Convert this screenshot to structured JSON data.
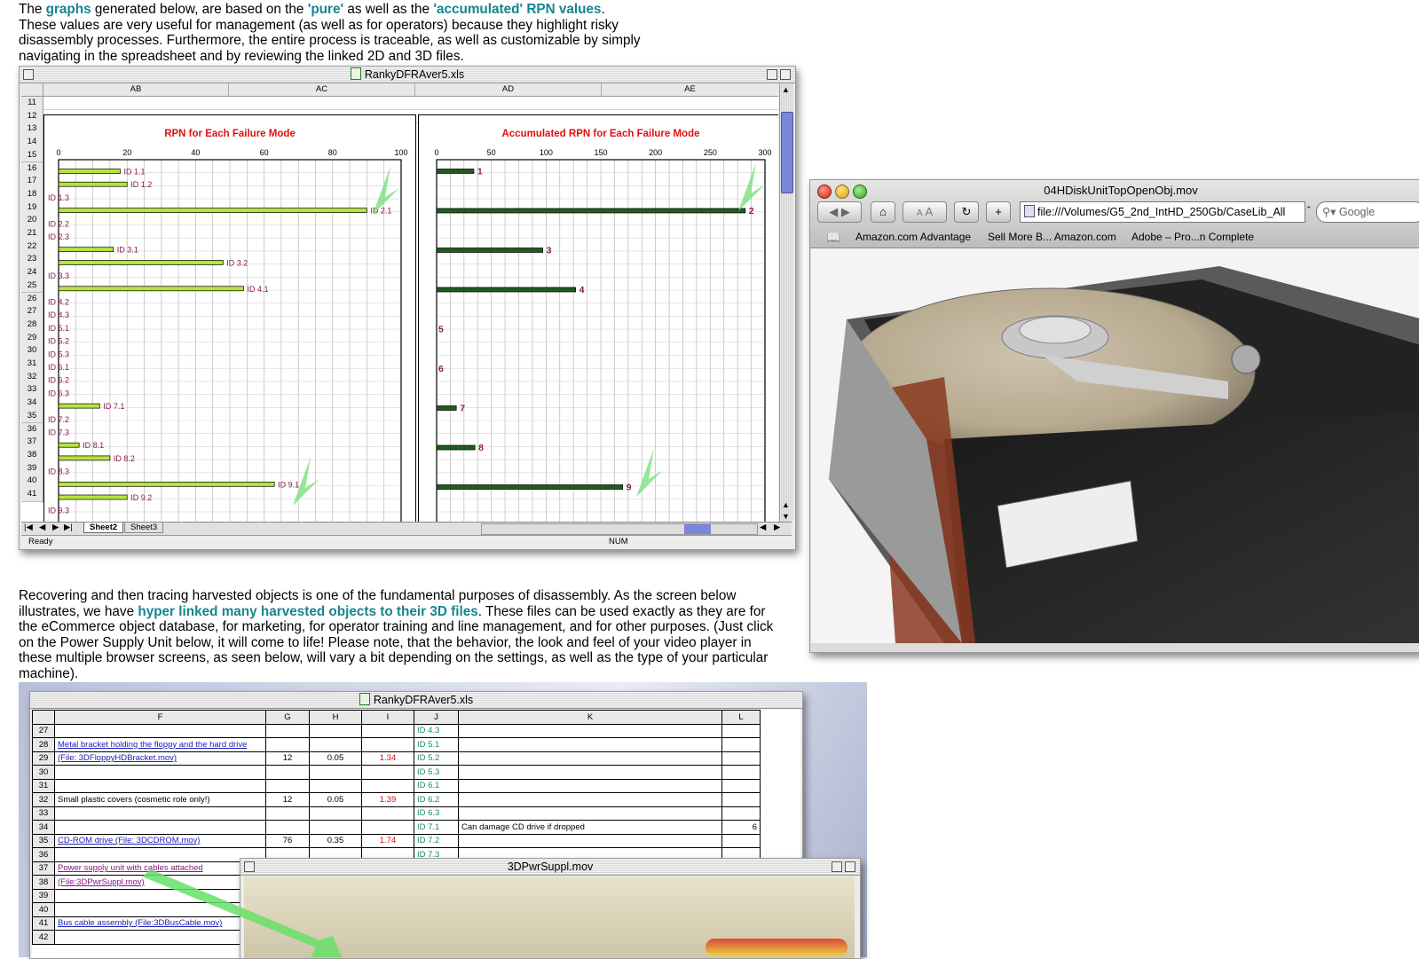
{
  "intro": {
    "t1": "The ",
    "graphs_link": "graphs",
    "t2": " generated below, are based on the ",
    "pure_link": "'pure'",
    "t3": " as well as the ",
    "accum_link": "'accumulated' RPN values",
    "t4": ".",
    "line2": "These values are very useful for management (as well as for operators) because they highlight risky",
    "line3": "disassembly processes. Furthermore, the entire process is traceable, as well as customizable by simply",
    "line4": "navigating in the spreadsheet and by reviewing the linked 2D and 3D files."
  },
  "excel1": {
    "title": "RankyDFRAver5.xls",
    "columns": [
      "AB",
      "AC",
      "AD",
      "AE"
    ],
    "rows": [
      "11",
      "12",
      "13",
      "14",
      "15",
      "16",
      "17",
      "18",
      "19",
      "20",
      "21",
      "22",
      "23",
      "24",
      "25",
      "26",
      "27",
      "28",
      "29",
      "30",
      "31",
      "32",
      "33",
      "34",
      "35",
      "36",
      "37",
      "38",
      "39",
      "40",
      "41"
    ],
    "tabs": [
      "Sheet2",
      "Sheet3"
    ],
    "status_left": "Ready",
    "status_num": "NUM"
  },
  "chart_data": [
    {
      "type": "bar",
      "orientation": "horizontal",
      "title": "RPN for Each Failure Mode",
      "categories": [
        "ID 1.1",
        "ID 1.2",
        "ID 1.3",
        "ID 2.1",
        "ID 2.2",
        "ID 2.3",
        "ID 3.1",
        "ID 3.2",
        "ID 3.3",
        "ID 4.1",
        "ID 4.2",
        "ID 4.3",
        "ID 5.1",
        "ID 5.2",
        "ID 5.3",
        "ID 6.1",
        "ID 6.2",
        "ID 6.3",
        "ID 7.1",
        "ID 7.2",
        "ID 7.3",
        "ID 8.1",
        "ID 8.2",
        "ID 8.3",
        "ID 9.1",
        "ID 9.2",
        "ID 9.3"
      ],
      "values": [
        18,
        20,
        0,
        90,
        0,
        0,
        16,
        48,
        0,
        54,
        0,
        0,
        0,
        0,
        0,
        0,
        0,
        0,
        12,
        0,
        0,
        6,
        15,
        0,
        63,
        20,
        0
      ],
      "xticks": [
        "0",
        "20",
        "40",
        "60",
        "80",
        "100"
      ],
      "xlim": [
        0,
        100
      ],
      "grid": true,
      "colors": {
        "bar": "#b7e33c",
        "label": "#8a1a4a",
        "title": "#e01010"
      }
    },
    {
      "type": "bar",
      "orientation": "horizontal",
      "title": "Accumulated RPN for Each Failure Mode",
      "categories": [
        "1",
        "2",
        "3",
        "4",
        "5",
        "6",
        "7",
        "8",
        "9"
      ],
      "values": [
        34,
        282,
        97,
        127,
        0,
        0,
        18,
        35,
        170
      ],
      "xticks": [
        "0",
        "50",
        "100",
        "150",
        "200",
        "250",
        "300"
      ],
      "xlim": [
        0,
        300
      ],
      "grid": true,
      "colors": {
        "bar": "#1f5a22",
        "label": "#8a1a4a",
        "title": "#e01010"
      }
    }
  ],
  "safari": {
    "title": "04HDiskUnitTopOpenObj.mov",
    "address": "file:///Volumes/G5_2nd_IntHD_250Gb/CaseLib_All",
    "search_placeholder": "Google",
    "font_smaller": "A",
    "font_larger": "A",
    "bookmarks": [
      "Amazon.com Advantage",
      "Sell More B... Amazon.com",
      "Adobe – Pro...n Complete"
    ]
  },
  "para2": {
    "l1": "Recovering and then tracing harvested objects is one of the fundamental purposes of disassembly. As the screen below",
    "l2a": "illustrates, we have ",
    "l2link": "hyper linked many harvested objects to their 3D files",
    "l2b": ". These files can be used exactly as they are for",
    "l3": "the eCommerce object database, for marketing, for operator training and line management, and for other purposes. (Just click",
    "l4": "on the Power Supply Unit below, it will come to life! Please note, that the behavior, the look and feel of your video player in",
    "l5": "these multiple browser screens, as seen below, will vary a bit depending on the settings, as well as the type of your particular",
    "l6": "machine)."
  },
  "excel2": {
    "title": "RankyDFRAver5.xls",
    "columns": [
      "F",
      "G",
      "H",
      "I",
      "J",
      "K",
      "L"
    ],
    "rows": [
      {
        "n": "27",
        "f": "",
        "g": "",
        "h": "",
        "i": "",
        "j": "ID 4.3",
        "k": "",
        "l": ""
      },
      {
        "n": "28",
        "f": "Metal bracket holding the floppy and the hard drive",
        "g": "",
        "h": "",
        "i": "",
        "j": "ID 5.1",
        "k": "",
        "l": ""
      },
      {
        "n": "29",
        "f": "(File: 3DFloppyHDBracket.mov)",
        "g": "12",
        "h": "0.05",
        "i": "1.34",
        "j": "ID 5.2",
        "k": "",
        "l": ""
      },
      {
        "n": "30",
        "f": "",
        "g": "",
        "h": "",
        "i": "",
        "j": "ID 5.3",
        "k": "",
        "l": ""
      },
      {
        "n": "31",
        "f": "",
        "g": "",
        "h": "",
        "i": "",
        "j": "ID 6.1",
        "k": "",
        "l": ""
      },
      {
        "n": "32",
        "f": "Small plastic covers (cosmetic role only!)",
        "g": "12",
        "h": "0.05",
        "i": "1.39",
        "j": "ID 6.2",
        "k": "",
        "l": ""
      },
      {
        "n": "33",
        "f": "",
        "g": "",
        "h": "",
        "i": "",
        "j": "ID 6.3",
        "k": "",
        "l": ""
      },
      {
        "n": "34",
        "f": "",
        "g": "",
        "h": "",
        "i": "",
        "j": "ID 7.1",
        "k": "Can damage CD drive if dropped",
        "l": "6"
      },
      {
        "n": "35",
        "f": "CD-ROM drive (File: 3DCDROM.mov)",
        "g": "76",
        "h": "0.35",
        "i": "1.74",
        "j": "ID 7.2",
        "k": "",
        "l": ""
      },
      {
        "n": "36",
        "f": "",
        "g": "",
        "h": "",
        "i": "",
        "j": "ID 7.3",
        "k": "",
        "l": ""
      },
      {
        "n": "37",
        "f": "Power supply unit with cables attached",
        "g": "",
        "h": "",
        "i": "",
        "j": "",
        "k": "",
        "l": ""
      },
      {
        "n": "38",
        "f": "(File:3DPwrSuppl.mov)",
        "g": "",
        "h": "",
        "i": "",
        "j": "",
        "k": "",
        "l": ""
      },
      {
        "n": "39",
        "f": "",
        "g": "",
        "h": "",
        "i": "",
        "j": "",
        "k": "",
        "l": ""
      },
      {
        "n": "40",
        "f": "",
        "g": "",
        "h": "",
        "i": "",
        "j": "",
        "k": "",
        "l": ""
      },
      {
        "n": "41",
        "f": "Bus cable assembly (File:3DBusCable.mov)",
        "g": "",
        "h": "",
        "i": "",
        "j": "",
        "k": "",
        "l": ""
      },
      {
        "n": "42",
        "f": "",
        "g": "",
        "h": "",
        "i": "",
        "j": "",
        "k": "",
        "l": ""
      }
    ]
  },
  "qt_window": {
    "title": "3DPwrSuppl.mov"
  },
  "colors": {
    "accent_link": "#16858f",
    "chart_title": "#e01010"
  }
}
